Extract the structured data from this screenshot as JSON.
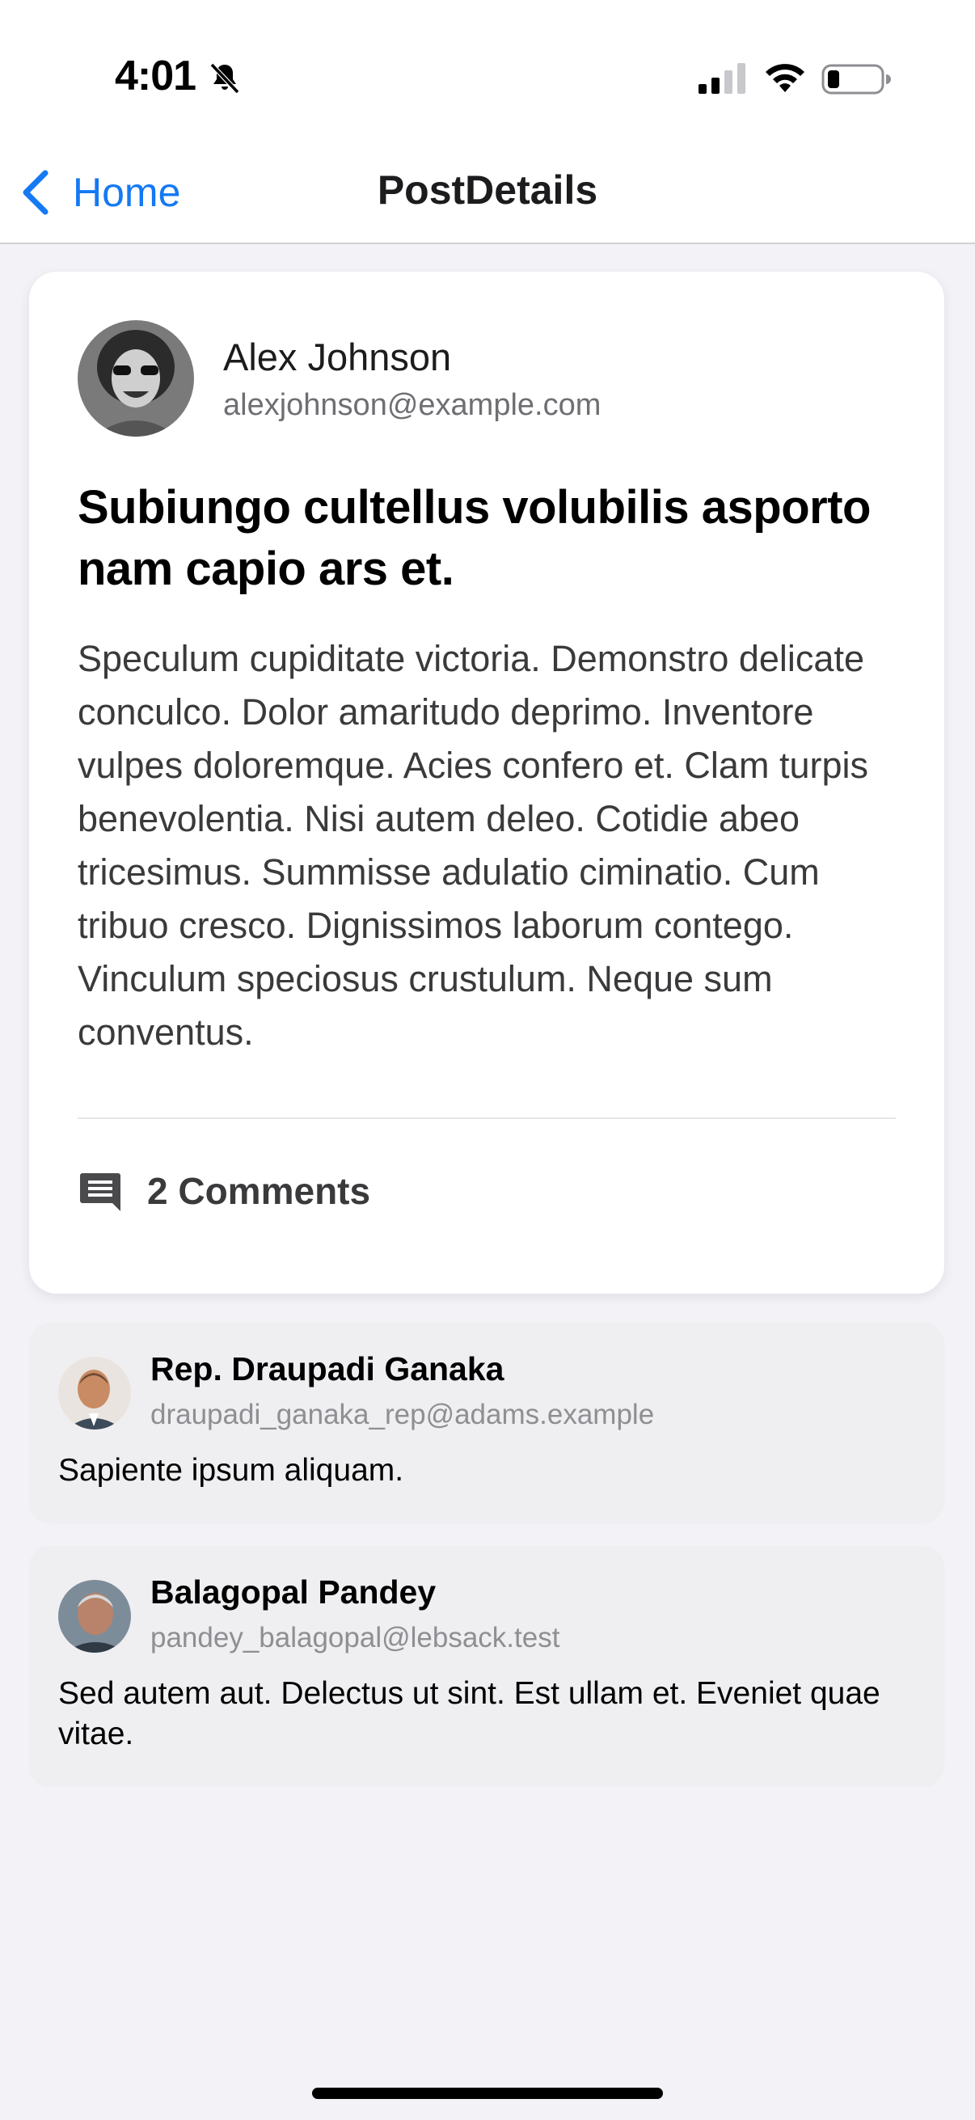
{
  "status_bar": {
    "time": "4:01",
    "bell_icon": "bell-slash-icon",
    "signal_icon": "cellular-signal-icon",
    "wifi_icon": "wifi-icon",
    "battery_icon": "battery-low-icon"
  },
  "nav": {
    "back_label": "Home",
    "back_icon": "chevron-left-icon",
    "title": "PostDetails"
  },
  "post": {
    "author": {
      "name": "Alex Johnson",
      "email": "alexjohnson@example.com"
    },
    "title": "Subiungo cultellus volubilis asporto nam capio ars et.",
    "body": "Speculum cupiditate victoria. Demonstro delicate conculco. Dolor amaritudo deprimo. Inventore vulpes doloremque. Acies confero et. Clam turpis benevolentia. Nisi autem deleo. Cotidie abeo tricesimus. Summisse adulatio ciminatio. Cum tribuo cresco. Dignissimos laborum contego. Vinculum speciosus crustulum. Neque sum conventus.",
    "comments_label": "2 Comments",
    "comments_icon": "comment-icon"
  },
  "comments": [
    {
      "name": "Rep. Draupadi Ganaka",
      "email": "draupadi_ganaka_rep@adams.example",
      "text": "Sapiente ipsum aliquam."
    },
    {
      "name": "Balagopal Pandey",
      "email": "pandey_balagopal@lebsack.test",
      "text": "Sed autem aut. Delectus ut sint. Est ullam et. Eveniet quae vitae."
    }
  ],
  "colors": {
    "accent": "#1479f3",
    "background": "#f2f2f7",
    "card": "#ffffff",
    "comment_card": "#efeff1"
  }
}
